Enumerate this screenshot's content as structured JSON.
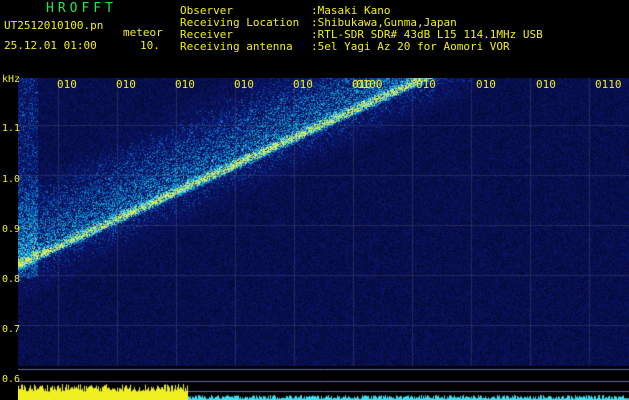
{
  "header": {
    "app_title": "HROFFT",
    "file_name": "UT2512010100.pn",
    "mode": "meteor",
    "date_time": "25.12.01 01:00",
    "count": "10."
  },
  "info": [
    {
      "key": "Observer",
      "value": ":Masaki Kano"
    },
    {
      "key": "Receiving Location",
      "value": ":Shibukawa,Gunma,Japan"
    },
    {
      "key": "Receiver",
      "value": ":RTL-SDR SDR# 43dB L15 114.1MHz USB"
    },
    {
      "key": "Receiving antenna",
      "value": ":5el Yagi Az 20 for Aomori VOR"
    }
  ],
  "axis": {
    "unit": "kHz",
    "y_ticks": [
      "1.1",
      "1.0",
      "0.9",
      "0.8",
      "0.7",
      "0.6"
    ],
    "x_ticks": [
      "010",
      "010",
      "010",
      "010",
      "010",
      "010",
      "0100",
      "010",
      "010",
      "010",
      "0110"
    ]
  },
  "colors": {
    "background": "#000000",
    "label_text": "#f2ee20",
    "title_text": "#22e844",
    "signal_low": "#1a2a9a",
    "signal_mid": "#00c0d8",
    "signal_high": "#f0f040"
  }
}
